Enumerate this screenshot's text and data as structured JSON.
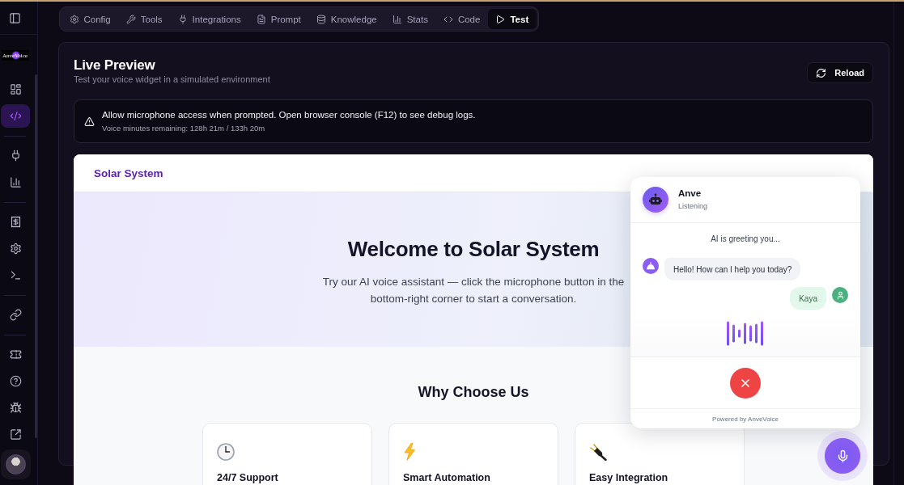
{
  "sidebar": {
    "logo": "AnveVoice",
    "groups": [
      {
        "items": [
          {
            "selected": false
          },
          {
            "selected": true
          }
        ]
      },
      {
        "items": [
          {
            "selected": false
          },
          {
            "selected": false
          }
        ]
      },
      {
        "items": [
          {
            "selected": false
          },
          {
            "selected": false
          },
          {
            "selected": false
          }
        ]
      },
      {
        "items": [
          {
            "selected": false
          }
        ]
      },
      {
        "items": [
          {
            "selected": false
          },
          {
            "selected": false
          },
          {
            "selected": false
          },
          {
            "selected": false
          }
        ]
      }
    ]
  },
  "tabs": [
    {
      "label": "Config",
      "selected": false
    },
    {
      "label": "Tools",
      "selected": false
    },
    {
      "label": "Integrations",
      "selected": false
    },
    {
      "label": "Prompt",
      "selected": false
    },
    {
      "label": "Knowledge",
      "selected": false
    },
    {
      "label": "Stats",
      "selected": false
    },
    {
      "label": "Code",
      "selected": false
    },
    {
      "label": "Test",
      "selected": true
    }
  ],
  "page": {
    "title": "Live Preview",
    "subtitle": "Test your voice widget in a simulated environment",
    "reload_button": "Reload"
  },
  "alert": {
    "message": "Allow microphone access when prompted. Open browser console (F12) to see debug logs.",
    "detail": "Voice minutes remaining: 128h 21m / 133h 20m"
  },
  "preview": {
    "brand": "Solar System",
    "hero": {
      "title": "Welcome to Solar System",
      "text": "Try our AI voice assistant — click the microphone button in the bottom-right corner to start a conversation."
    },
    "features": {
      "title": "Why Choose Us",
      "cards": [
        {
          "title": "24/7 Support"
        },
        {
          "title": "Smart Automation"
        },
        {
          "title": "Easy Integration"
        }
      ]
    }
  },
  "widget": {
    "agent_name": "Anve",
    "status": "Listening",
    "notice": "AI is greeting you...",
    "messages": [
      {
        "kind": "agent",
        "text": "Hello! How can I help you today?"
      },
      {
        "kind": "user",
        "text": "Kaya"
      }
    ],
    "footer": "Powered by AnveVoice"
  }
}
